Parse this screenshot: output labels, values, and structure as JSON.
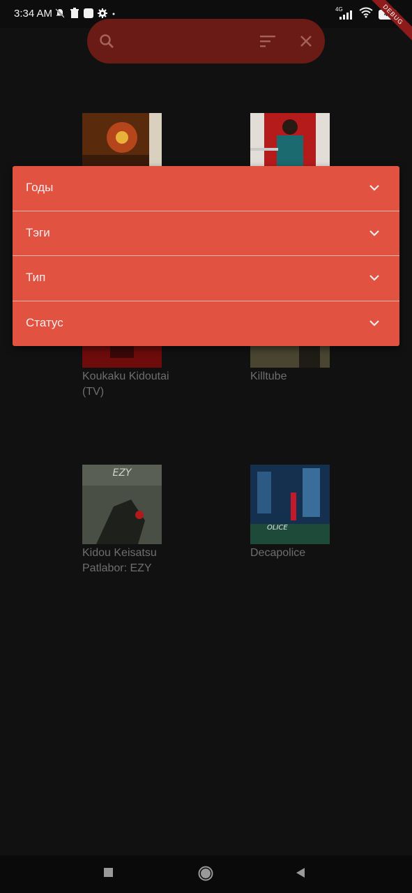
{
  "status_bar": {
    "time": "3:34 AM",
    "network_label": "4G",
    "battery": "43",
    "debug_banner": "DEBUG",
    "left_icons": [
      "notifications-off-icon",
      "trash-icon",
      "app-icon",
      "settings-icon",
      "dot-icon"
    ],
    "right_icons": [
      "signal-icon",
      "wifi-icon",
      "battery-icon"
    ]
  },
  "search": {
    "placeholder": "",
    "value": ""
  },
  "filters": [
    {
      "label": "Годы"
    },
    {
      "label": "Тэги"
    },
    {
      "label": "Тип"
    },
    {
      "label": "Статус"
    }
  ],
  "grid": {
    "items": [
      {
        "title": "",
        "cover_color": "#6b3a12"
      },
      {
        "title": "",
        "cover_color": "#a51717"
      },
      {
        "title": "Koukaku Kidoutai (TV)",
        "cover_color": "#7a0c0c"
      },
      {
        "title": "Killtube",
        "cover_color": "#3a3520"
      },
      {
        "title": "Kidou Keisatsu Patlabor: EZY",
        "cover_color": "#3b3f38"
      },
      {
        "title": "Decapolice",
        "cover_color": "#1a3a60"
      }
    ]
  },
  "colors": {
    "accent": "#e15241",
    "background": "#111111",
    "search_pill": "#6a1b15"
  },
  "nav": {
    "buttons": [
      "recents-button",
      "home-button",
      "back-button"
    ]
  }
}
